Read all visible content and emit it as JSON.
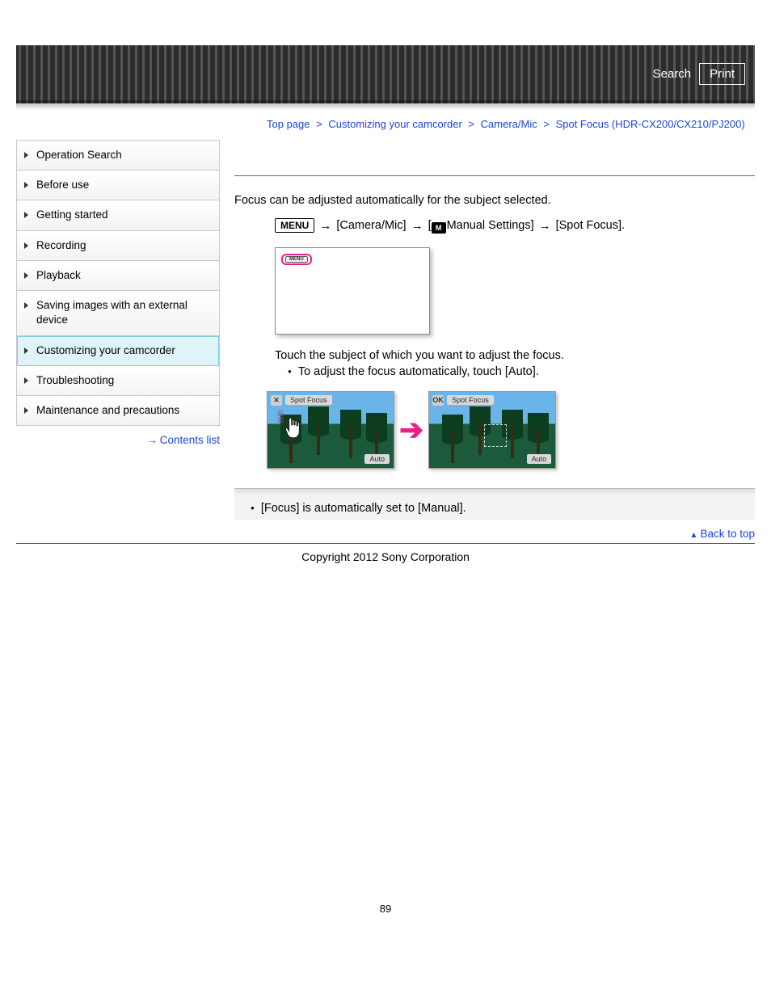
{
  "header": {
    "search_label": "Search",
    "print_label": "Print"
  },
  "breadcrumb": {
    "top": "Top page",
    "sep": ">",
    "cat1": "Customizing your camcorder",
    "cat2": "Camera/Mic",
    "current": "Spot Focus (HDR-CX200/CX210/PJ200)"
  },
  "sidebar": {
    "items": [
      {
        "label": "Operation Search"
      },
      {
        "label": "Before use"
      },
      {
        "label": "Getting started"
      },
      {
        "label": "Recording"
      },
      {
        "label": "Playback"
      },
      {
        "label": "Saving images with an external device"
      },
      {
        "label": "Customizing your camcorder",
        "active": true
      },
      {
        "label": "Troubleshooting"
      },
      {
        "label": "Maintenance and precautions"
      }
    ],
    "contents_list": "Contents list"
  },
  "content": {
    "intro": "Focus can be adjusted automatically for the subject selected.",
    "menu_label": "MENU",
    "path1": "[Camera/Mic]",
    "path2_pre": "[",
    "path2_icon": "M",
    "path2": "Manual Settings]",
    "path3": "[Spot Focus].",
    "screen_menu_text": "MENU",
    "touch_text": "Touch the subject of which you want to adjust the focus.",
    "touch_bullet": "To adjust the focus automatically, touch [Auto].",
    "img_left": {
      "corner": "✕",
      "label": "Spot Focus",
      "auto": "Auto"
    },
    "img_right": {
      "corner": "OK",
      "label": "Spot Focus",
      "auto": "Auto"
    },
    "note": "[Focus] is automatically set to [Manual]."
  },
  "footer": {
    "back_to_top": "Back to top",
    "copyright": "Copyright 2012 Sony Corporation",
    "page_number": "89"
  }
}
